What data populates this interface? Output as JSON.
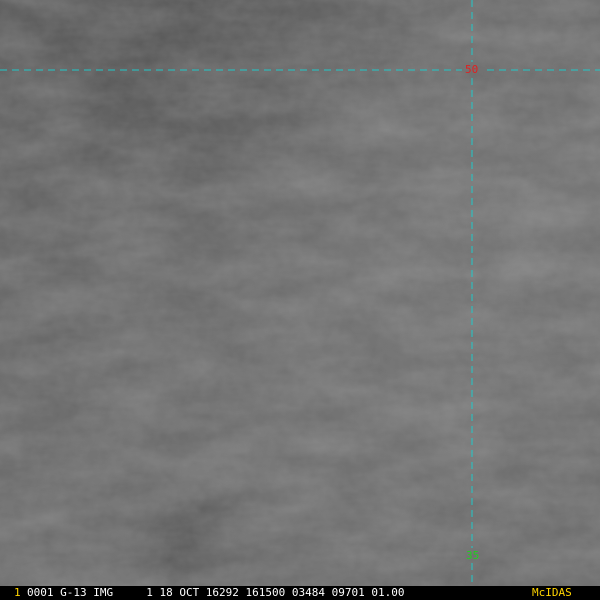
{
  "lat_labels": {
    "top": {
      "text": "50",
      "color": "#e02020"
    },
    "bottom": {
      "text": "35",
      "color": "#20d020"
    }
  },
  "grid": {
    "color": "#21c8c8"
  },
  "status_bar": {
    "frame_number": "1",
    "frame_number_color": "#ffd400",
    "text": "0001 G-13 IMG     1 18 OCT 16292 161500 03484 09701 01.00",
    "text_color": "#ffffff",
    "brand": "McIDAS",
    "brand_color": "#ffd400"
  }
}
